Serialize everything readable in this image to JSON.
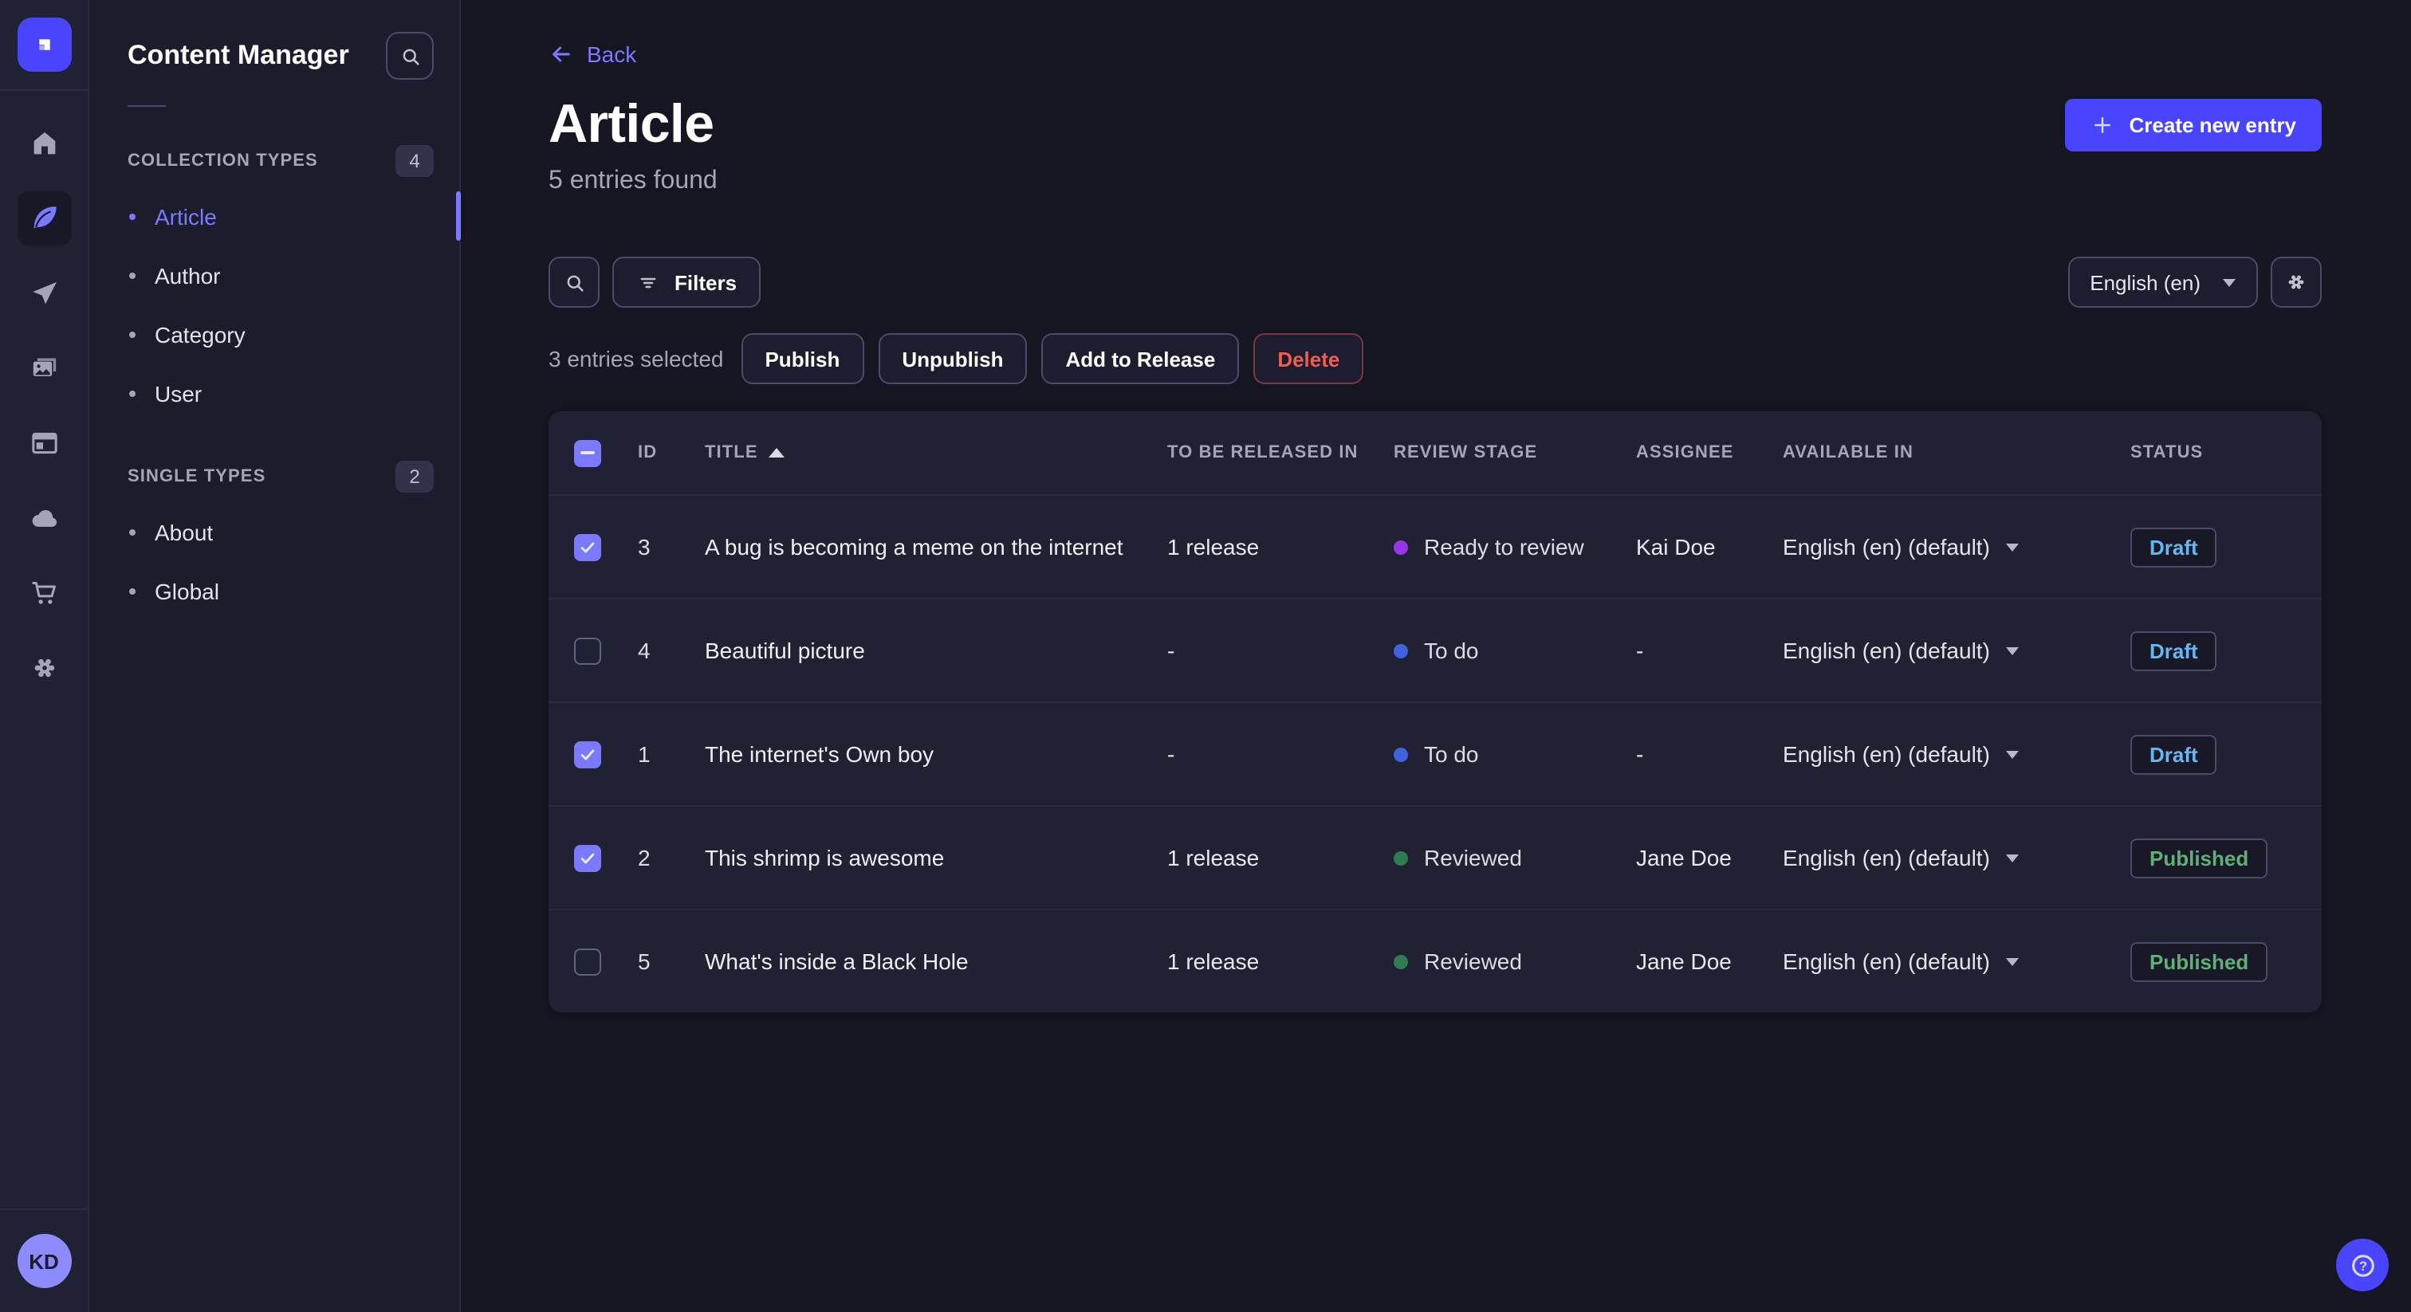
{
  "colors": {
    "brand": "#4945ff",
    "accent": "#7b79ff",
    "draft": "#66b7f1",
    "published": "#5cb176",
    "danger": "#ee5e52",
    "stage_todo": "#3e63dd",
    "stage_ready": "#9736e8",
    "stage_reviewed": "#2e7d52"
  },
  "rail": {
    "logo_icon": "strapi-logo",
    "icons": [
      "home-icon",
      "content-manager-icon",
      "send-icon",
      "media-library-icon",
      "content-type-builder-icon",
      "cloud-icon",
      "marketplace-icon",
      "settings-icon"
    ],
    "avatar_initials": "KD"
  },
  "sidebar": {
    "title": "Content Manager",
    "sections": [
      {
        "label": "COLLECTION TYPES",
        "badge": "4",
        "items": [
          {
            "label": "Article",
            "active": true
          },
          {
            "label": "Author"
          },
          {
            "label": "Category"
          },
          {
            "label": "User"
          }
        ]
      },
      {
        "label": "SINGLE TYPES",
        "badge": "2",
        "items": [
          {
            "label": "About"
          },
          {
            "label": "Global"
          }
        ]
      }
    ]
  },
  "header": {
    "back": "Back",
    "title": "Article",
    "subtitle": "5 entries found",
    "create": "Create new entry"
  },
  "toolbar": {
    "filters": "Filters",
    "locale": "English (en)"
  },
  "selection": {
    "summary": "3 entries selected",
    "publish": "Publish",
    "unpublish": "Unpublish",
    "add_to_release": "Add to Release",
    "delete": "Delete"
  },
  "table": {
    "columns": {
      "id": "ID",
      "title": "TITLE",
      "released": "TO BE RELEASED IN",
      "stage": "REVIEW STAGE",
      "assignee": "ASSIGNEE",
      "available": "AVAILABLE IN",
      "status": "STATUS"
    },
    "rows": [
      {
        "checked": true,
        "id": "3",
        "title": "A bug is becoming a meme on the internet",
        "release": "1 release",
        "has_release": true,
        "stage": "Ready to review",
        "stage_color": "#9736e8",
        "assignee": "Kai Doe",
        "available": "English (en) (default)",
        "status": "Draft",
        "status_color": "#66b7f1"
      },
      {
        "checked": false,
        "id": "4",
        "title": "Beautiful picture",
        "release": "-",
        "has_release": false,
        "stage": "To do",
        "stage_color": "#3e63dd",
        "assignee": "-",
        "available": "English (en) (default)",
        "status": "Draft",
        "status_color": "#66b7f1"
      },
      {
        "checked": true,
        "id": "1",
        "title": "The internet's Own boy",
        "release": "-",
        "has_release": false,
        "stage": "To do",
        "stage_color": "#3e63dd",
        "assignee": "-",
        "available": "English (en) (default)",
        "status": "Draft",
        "status_color": "#66b7f1"
      },
      {
        "checked": true,
        "id": "2",
        "title": "This shrimp is awesome",
        "release": "1 release",
        "has_release": true,
        "stage": "Reviewed",
        "stage_color": "#2e7d52",
        "assignee": "Jane Doe",
        "available": "English (en) (default)",
        "status": "Published",
        "status_color": "#5cb176"
      },
      {
        "checked": false,
        "id": "5",
        "title": "What's inside a Black Hole",
        "release": "1 release",
        "has_release": true,
        "stage": "Reviewed",
        "stage_color": "#2e7d52",
        "assignee": "Jane Doe",
        "available": "English (en) (default)",
        "status": "Published",
        "status_color": "#5cb176"
      }
    ]
  }
}
